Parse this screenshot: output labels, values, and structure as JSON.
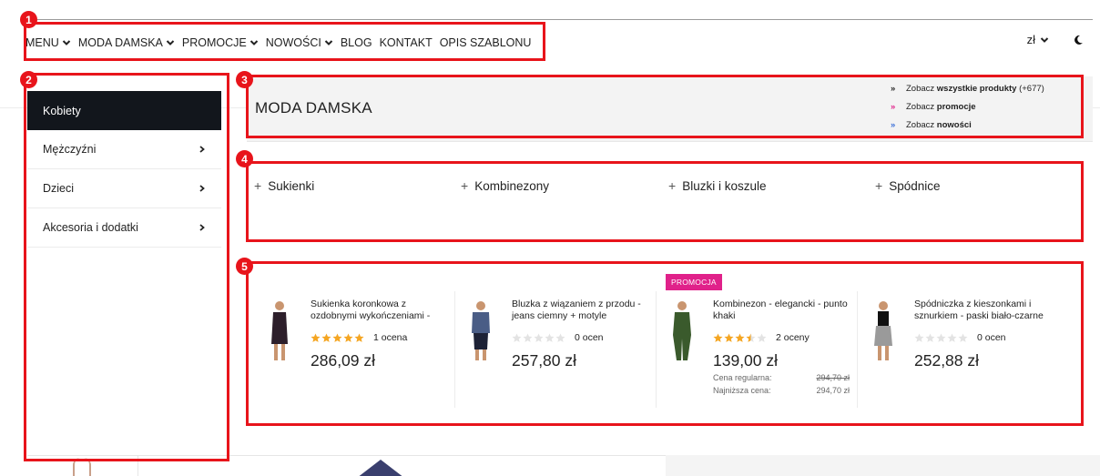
{
  "nav": {
    "items": [
      {
        "label": "MENU",
        "dropdown": true
      },
      {
        "label": "MODA DAMSKA",
        "dropdown": true
      },
      {
        "label": "PROMOCJE",
        "dropdown": true
      },
      {
        "label": "NOWOŚCI",
        "dropdown": true
      },
      {
        "label": "BLOG",
        "dropdown": false
      },
      {
        "label": "KONTAKT",
        "dropdown": false
      },
      {
        "label": "OPIS SZABLONU",
        "dropdown": false
      }
    ],
    "currency": "zł",
    "theme_icon": "moon-icon"
  },
  "sidebar": {
    "items": [
      {
        "label": "Kobiety",
        "active": true
      },
      {
        "label": "Mężczyźni",
        "active": false
      },
      {
        "label": "Dzieci",
        "active": false
      },
      {
        "label": "Akcesoria i dodatki",
        "active": false
      }
    ]
  },
  "mega": {
    "title": "MODA DAMSKA",
    "links": [
      {
        "prefix": "Zobacz ",
        "emph": "wszystkie produkty",
        "suffix": " (+677)",
        "color": "#222222"
      },
      {
        "prefix": "Zobacz ",
        "emph": "promocje",
        "suffix": "",
        "color": "#e0218a"
      },
      {
        "prefix": "Zobacz ",
        "emph": "nowości",
        "suffix": "",
        "color": "#3a6fd8"
      }
    ]
  },
  "categories": [
    "Sukienki",
    "Kombinezony",
    "Bluzki i koszule",
    "Spódnice"
  ],
  "products": [
    {
      "name": "Sukienka koronkowa z ozdobnymi wykończeniami -",
      "rating": 5,
      "rating_text": "1 ocena",
      "price": "286,09 zł",
      "promo": false
    },
    {
      "name": "Bluzka z wiązaniem z przodu - jeans ciemny + motyle",
      "rating": 0,
      "rating_text": "0 ocen",
      "price": "257,80 zł",
      "promo": false
    },
    {
      "name": "Kombinezon - elegancki - punto khaki",
      "rating": 3.5,
      "rating_text": "2 oceny",
      "price": "139,00 zł",
      "promo": true,
      "badge": "PROMOCJA",
      "regular_label": "Cena regularna:",
      "regular_price": "294,70 zł",
      "lowest_label": "Najniższa cena:",
      "lowest_price": "294,70 zł"
    },
    {
      "name": "Spódniczka z kieszonkami i sznurkiem - paski biało-czarne",
      "rating": 0,
      "rating_text": "0 ocen",
      "price": "252,88 zł",
      "promo": false
    }
  ],
  "annotations": [
    "1",
    "2",
    "3",
    "4",
    "5"
  ],
  "colors": {
    "accent_pink": "#e0218a",
    "accent_blue": "#3a6fd8",
    "star_gold": "#f5a623",
    "annotation_red": "#e8141b",
    "active_sidebar": "#12161c"
  }
}
